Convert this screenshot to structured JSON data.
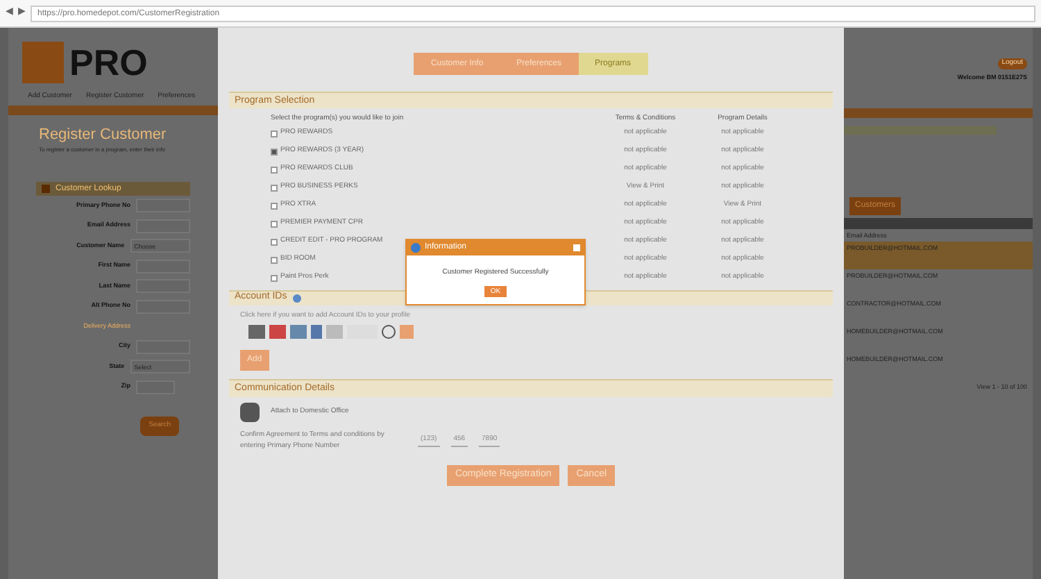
{
  "browser": {
    "back": "◀",
    "forward": "▶",
    "url": "https://pro.homedepot.com/CustomerRegistration"
  },
  "header": {
    "logo_text": "PRO",
    "logout": "Logout",
    "welcome": "Welcome BM 0151E27S"
  },
  "nav": [
    "Add Customer",
    "Register Customer",
    "Preferences"
  ],
  "page": {
    "title": "Register Customer",
    "subtitle": "To register a customer in a program, enter their info"
  },
  "lookup": {
    "title": "Customer Lookup",
    "fields": [
      {
        "label": "Primary Phone No",
        "kind": "text"
      },
      {
        "label": "Email Address",
        "kind": "text"
      },
      {
        "label": "Customer Name",
        "kind": "select",
        "value": "Choose"
      },
      {
        "label": "First Name",
        "kind": "text"
      },
      {
        "label": "Last Name",
        "kind": "text"
      },
      {
        "label": "Alt Phone No",
        "kind": "text"
      },
      {
        "label": "Delivery Address",
        "kind": "heading"
      },
      {
        "label": "City",
        "kind": "text"
      },
      {
        "label": "State",
        "kind": "select",
        "value": "Select"
      },
      {
        "label": "Zip",
        "kind": "short"
      }
    ],
    "button": "Search"
  },
  "results": {
    "tab": "Customers",
    "column": "Email Address",
    "rows": [
      {
        "email": "PROBUILDER@HOTMAIL.COM",
        "selected": true
      },
      {
        "email": "PROBUILDER@HOTMAIL.COM",
        "selected": false
      },
      {
        "email": "CONTRACTOR@HOTMAIL.COM",
        "selected": false
      },
      {
        "email": "HOMEBUILDER@HOTMAIL.COM",
        "selected": false
      },
      {
        "email": "HOMEBUILDER@HOTMAIL.COM",
        "selected": false
      }
    ],
    "pager": "View 1 - 10 of 100"
  },
  "modal": {
    "steps": [
      {
        "label": "Customer Info",
        "selected": false
      },
      {
        "label": "Preferences",
        "selected": false
      },
      {
        "label": "Programs",
        "selected": true
      }
    ],
    "program_section": "Program Selection",
    "instruction": "Select the program(s) you would like to join",
    "columns": [
      "Terms & Conditions",
      "Program Details"
    ],
    "programs": [
      {
        "name": "PRO REWARDS",
        "checked": false,
        "terms": "not applicable",
        "details": "not applicable"
      },
      {
        "name": "PRO REWARDS (3 YEAR)",
        "checked": true,
        "terms": "not applicable",
        "details": "not applicable"
      },
      {
        "name": "PRO REWARDS CLUB",
        "checked": false,
        "terms": "not applicable",
        "details": "not applicable"
      },
      {
        "name": "PRO BUSINESS PERKS",
        "checked": false,
        "terms": "View & Print",
        "details": "not applicable"
      },
      {
        "name": "PRO XTRA",
        "checked": false,
        "terms": "not applicable",
        "details": "View & Print"
      },
      {
        "name": "PREMIER PAYMENT CPR",
        "checked": false,
        "terms": "not applicable",
        "details": "not applicable"
      },
      {
        "name": "CREDIT EDIT - PRO PROGRAM",
        "checked": false,
        "terms": "not applicable",
        "details": "not applicable"
      },
      {
        "name": "BID ROOM",
        "checked": false,
        "terms": "not applicable",
        "details": "not applicable"
      },
      {
        "name": "Paint Pros Perk",
        "checked": false,
        "terms": "not applicable",
        "details": "not applicable"
      }
    ],
    "account_section": "Account IDs",
    "account_hint": "Click here if you want to add Account IDs to your profile",
    "add_button": "Add",
    "comm_section": "Communication Details",
    "comm_option": "Attach to Domestic Office",
    "confirm_text": "Confirm Agreement to Terms and conditions by entering Primary Phone Number",
    "phone": [
      "(123)",
      "456",
      "7890"
    ],
    "buttons": [
      "Complete Registration",
      "Cancel"
    ]
  },
  "dialog": {
    "title": "Information",
    "message": "Customer Registered Successfully",
    "ok": "OK"
  }
}
